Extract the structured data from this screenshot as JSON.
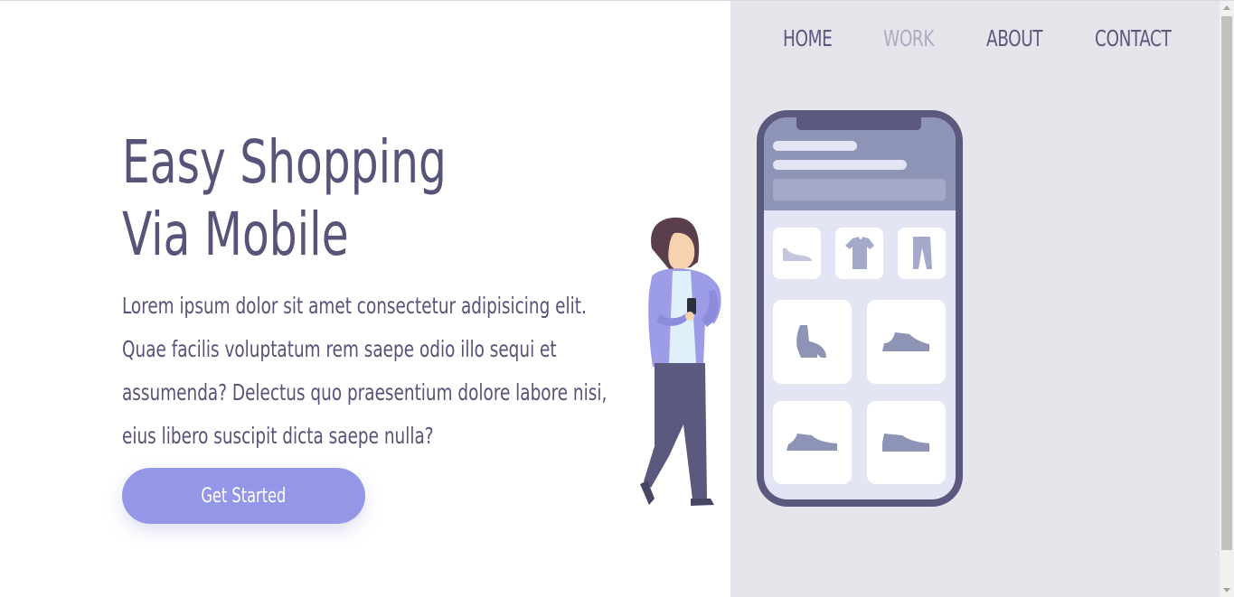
{
  "nav": {
    "items": [
      {
        "label": "HOME",
        "active": false
      },
      {
        "label": "WORK",
        "active": true
      },
      {
        "label": "ABOUT",
        "active": false
      },
      {
        "label": "CONTACT",
        "active": false
      }
    ]
  },
  "hero": {
    "title_line1": "Easy Shopping",
    "title_line2": "Via Mobile",
    "description": "Lorem ipsum dolor sit amet consectetur adipisicing elit. Quae facilis voluptatum rem saepe odio illo sequi et assumenda? Delectus quo praesentium dolore labore nisi, eius libero suscipit dicta saepe nulla?",
    "cta_label": "Get Started"
  },
  "illustration": {
    "icons": [
      "person-with-phone-icon",
      "smartphone-icon",
      "flat-shoe-icon",
      "tshirt-icon",
      "pants-icon",
      "boot-icon",
      "sneaker-icon",
      "sneaker-icon",
      "sneaker-icon"
    ]
  },
  "colors": {
    "text": "#555479",
    "nav_active": "#acabc1",
    "accent": "#9497e8",
    "panel": "#e6e5eb",
    "phone_frame": "#5b5a7e"
  }
}
